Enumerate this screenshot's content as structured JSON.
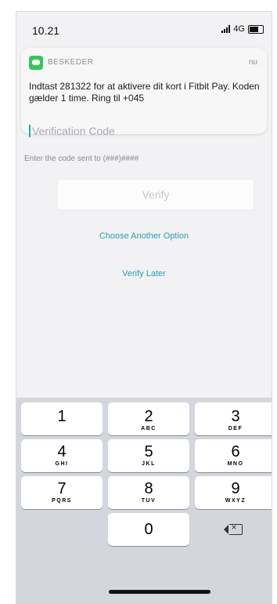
{
  "status_bar": {
    "time": "10.21",
    "carrier": "4G"
  },
  "notification": {
    "app_name": "BESKEDER",
    "time": "nu",
    "message": "Indtast 281322 for at aktivere dit kort i Fitbit Pay. Koden gælder 1 time. Ring til +045"
  },
  "code_input": {
    "placeholder": "Verification Code"
  },
  "hint": "Enter the code sent to (###)####",
  "verify_button": "Verify",
  "links": {
    "choose_another": "Choose Another Option",
    "verify_later": "Verify Later"
  },
  "keypad": {
    "keys": [
      {
        "number": "1",
        "letters": ""
      },
      {
        "number": "2",
        "letters": "ABC"
      },
      {
        "number": "3",
        "letters": "DEF"
      },
      {
        "number": "4",
        "letters": "GHI"
      },
      {
        "number": "5",
        "letters": "JKL"
      },
      {
        "number": "6",
        "letters": "MNO"
      },
      {
        "number": "7",
        "letters": "PQRS"
      },
      {
        "number": "8",
        "letters": "TUV"
      },
      {
        "number": "9",
        "letters": "WXYZ"
      },
      {
        "number": "0",
        "letters": ""
      }
    ]
  }
}
